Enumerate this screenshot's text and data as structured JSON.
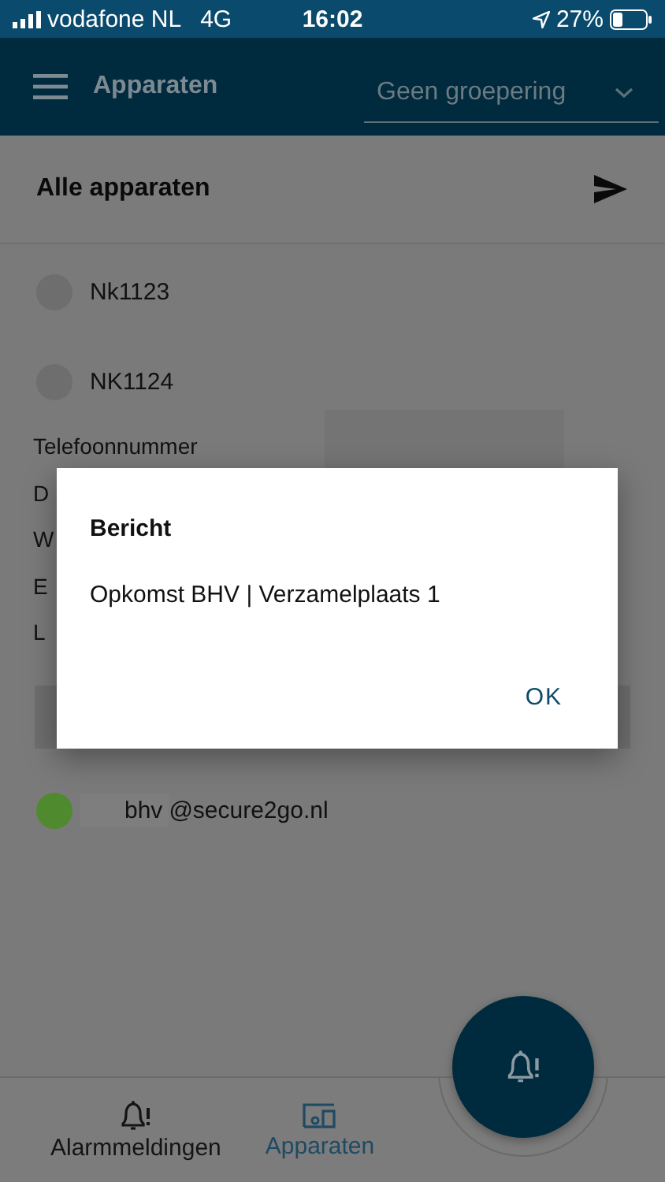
{
  "status_bar": {
    "carrier": "vodafone NL",
    "network": "4G",
    "time": "16:02",
    "battery": "27%"
  },
  "app_bar": {
    "title": "Apparaten",
    "grouping": {
      "value": "Geen groepering"
    }
  },
  "list_header": {
    "title": "Alle apparaten"
  },
  "devices": [
    {
      "name": "Nk1123",
      "color": "#6e6e6e"
    },
    {
      "name": "NK1124",
      "color": "#6e6e6e",
      "details": [
        "Telefoonnummer",
        "D",
        "W",
        "E",
        "L"
      ]
    }
  ],
  "contacts": [
    {
      "name_part": "bhv",
      "domain": "@secure2go.nl",
      "color": "#4f8a2e"
    }
  ],
  "dialog": {
    "title": "Bericht",
    "message": "Opkomst BHV | Verzamelplaats 1",
    "buttons": [
      "OK"
    ]
  },
  "nav": [
    {
      "label": "Alarmmeldingen",
      "selected": false
    },
    {
      "label": "Apparaten",
      "selected": true
    }
  ]
}
